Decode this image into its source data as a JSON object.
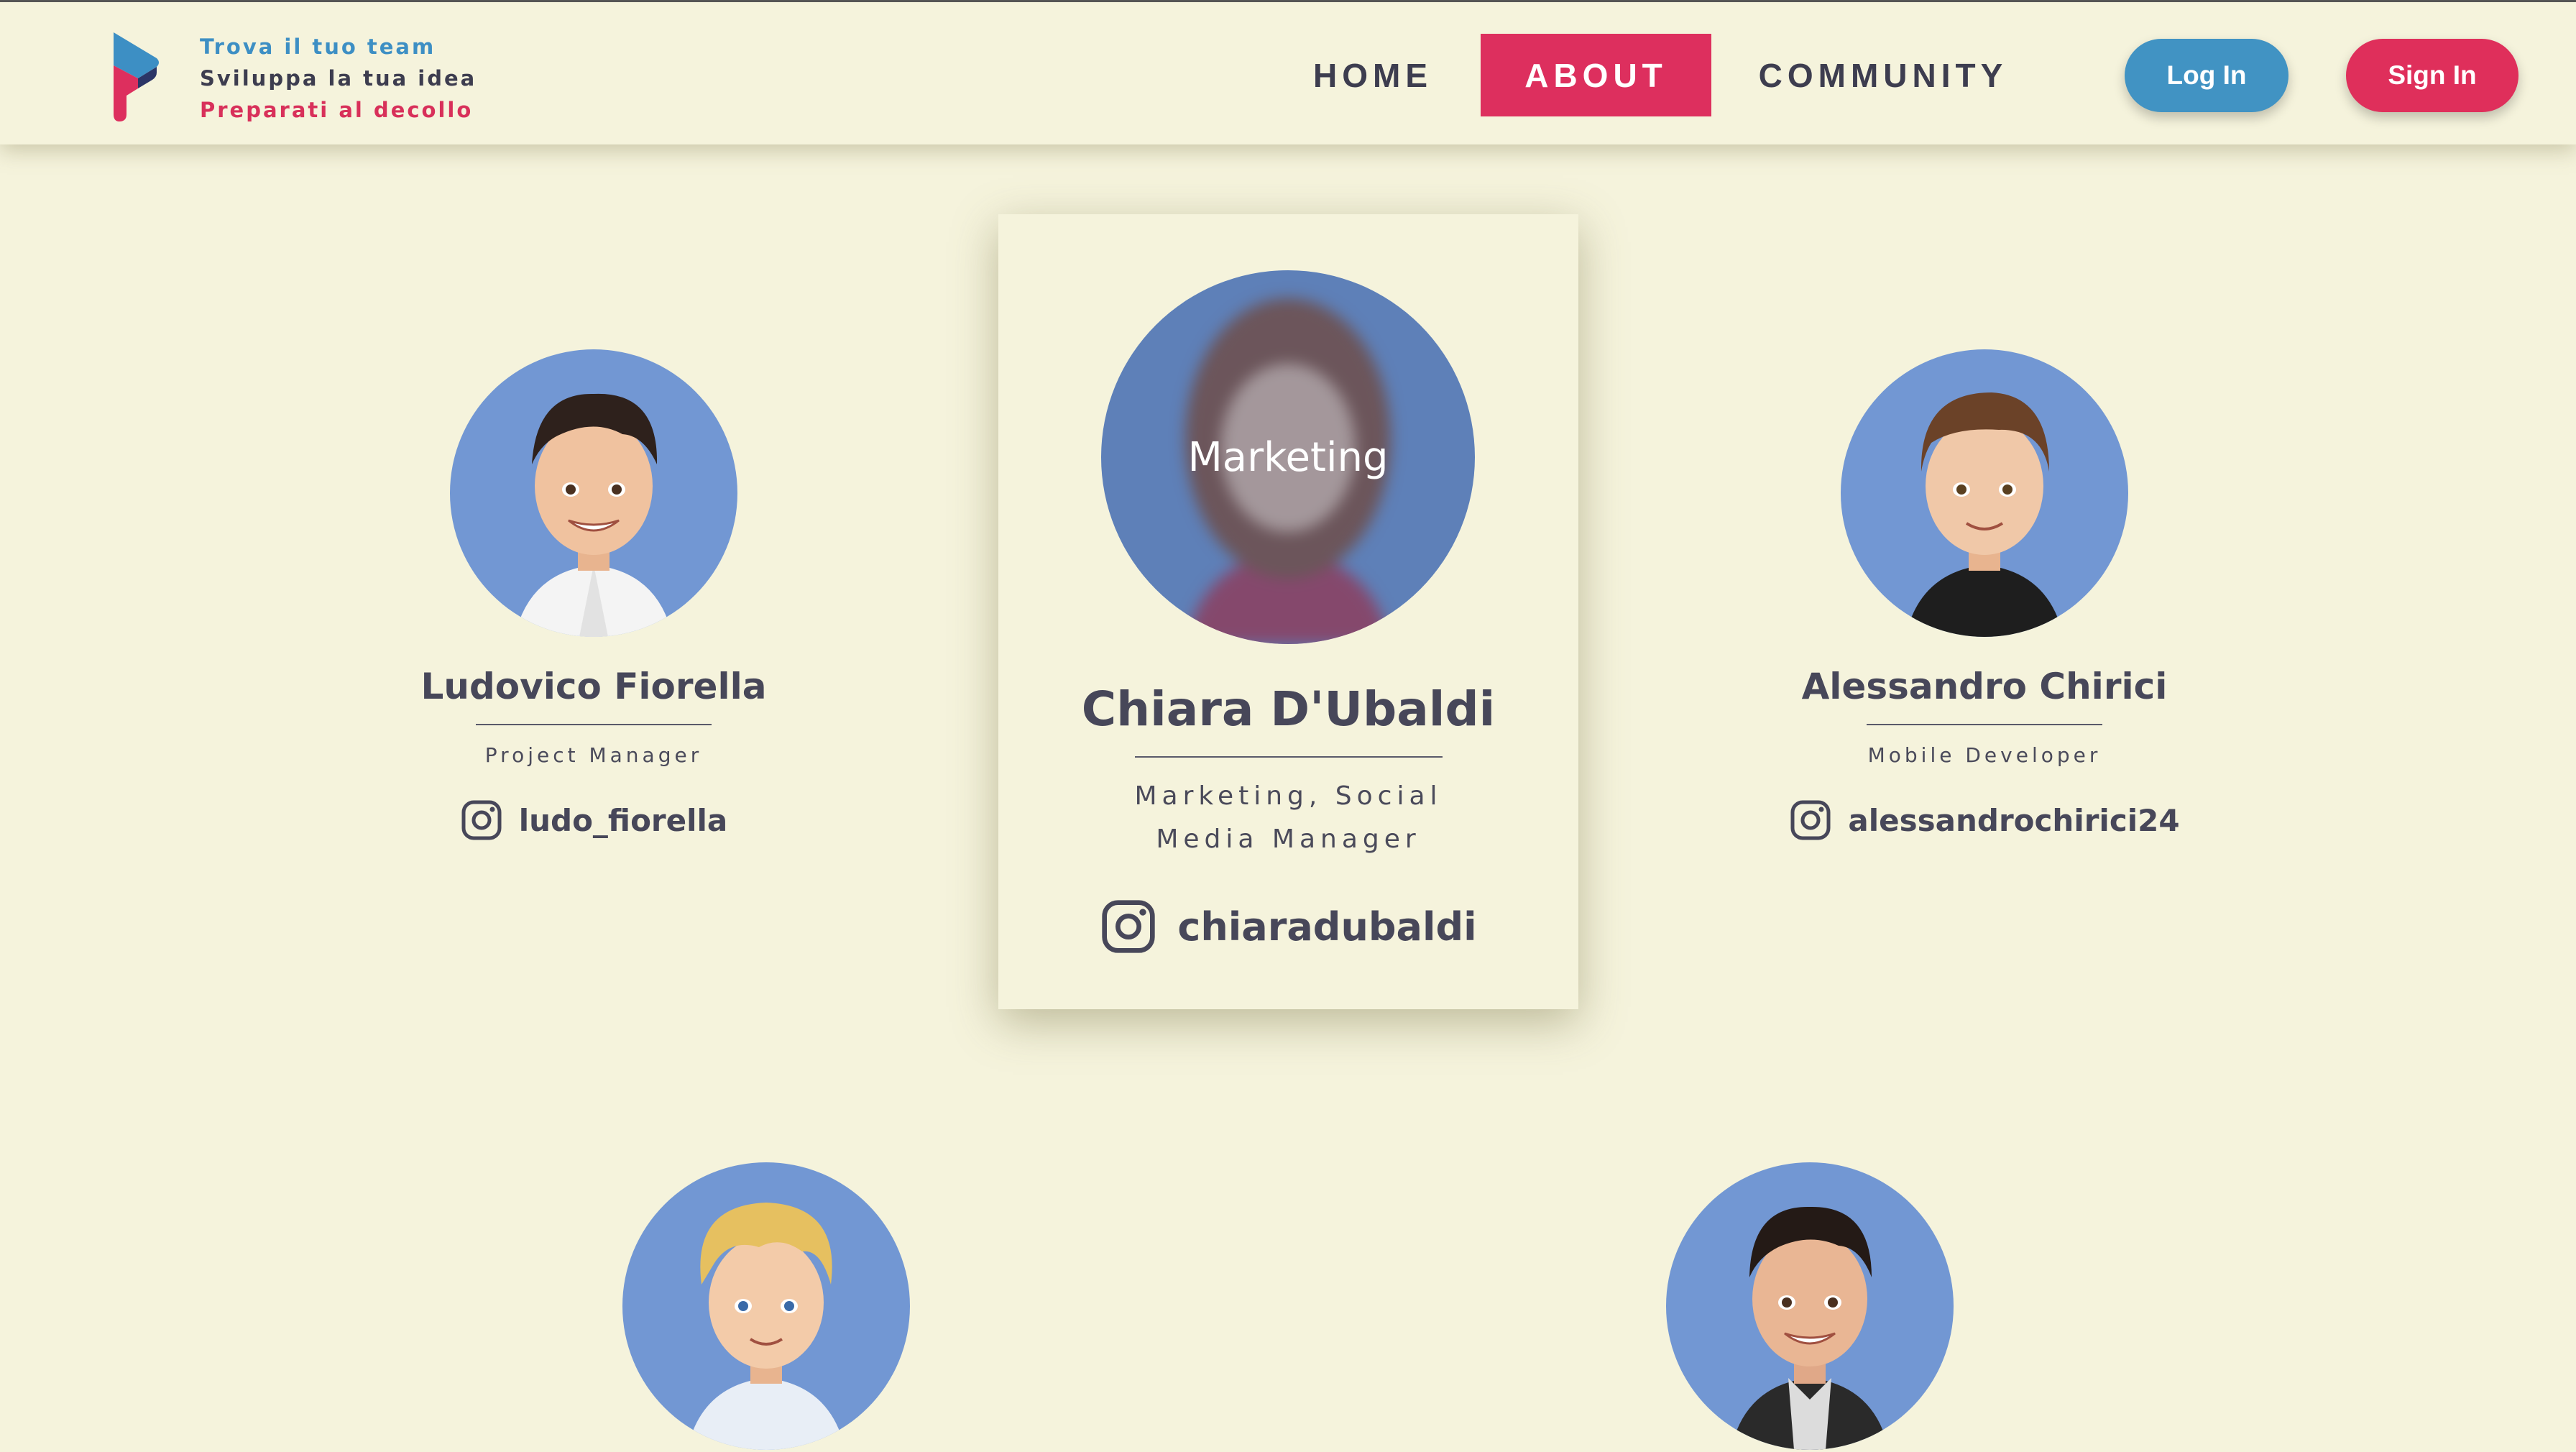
{
  "header": {
    "taglines": [
      "Trova il tuo team",
      "Sviluppa la tua idea",
      "Preparati al decollo"
    ],
    "nav": {
      "home": "HOME",
      "about": "ABOUT",
      "community": "COMMUNITY"
    },
    "login_label": "Log In",
    "signin_label": "Sign In"
  },
  "colors": {
    "background": "#f5f3dc",
    "accent_pink": "#dd2f5e",
    "accent_blue": "#4193c3",
    "avatar_bg": "#7297d3",
    "text_dark": "#474759"
  },
  "team": [
    {
      "name": "Ludovico Fiorella",
      "role": "Project Manager",
      "instagram": "ludo_fiorella"
    },
    {
      "name": "Chiara D'Ubaldi",
      "role": "Marketing, Social Media Manager",
      "instagram": "chiaradubaldi",
      "hover_label": "Marketing"
    },
    {
      "name": "Alessandro Chirici",
      "role": "Mobile Developer",
      "instagram": "alessandrochirici24"
    }
  ],
  "icons": {
    "instagram": "instagram-icon",
    "logo": "logo-icon"
  }
}
